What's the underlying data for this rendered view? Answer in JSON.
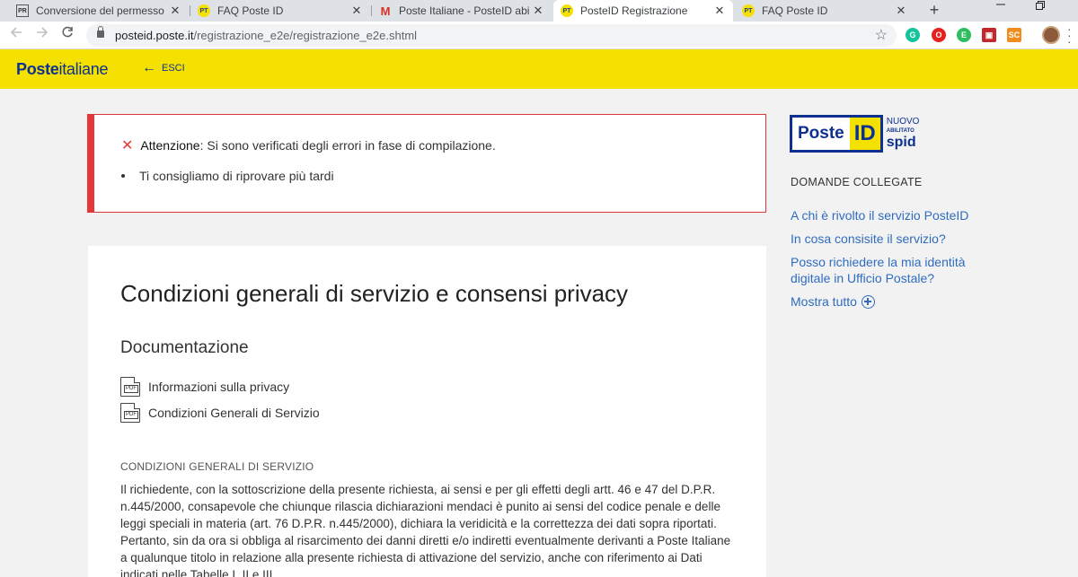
{
  "browser": {
    "tabs": [
      {
        "title": "Conversione del permesso di s",
        "favicon": "pr",
        "active": false
      },
      {
        "title": "FAQ Poste ID",
        "favicon": "pt",
        "active": false
      },
      {
        "title": "Poste Italiane - PosteID abilitat",
        "favicon": "gm",
        "active": false
      },
      {
        "title": "PosteID Registrazione",
        "favicon": "pt",
        "active": true
      },
      {
        "title": "FAQ Poste ID",
        "favicon": "pt",
        "active": false
      }
    ],
    "favicon_text": {
      "pt": "PT",
      "gm": "M",
      "pr": "PR"
    },
    "close_glyph": "✕",
    "new_tab": "+",
    "url_host": "posteid.poste.it",
    "url_path": "/registrazione_e2e/registrazione_e2e.shtml",
    "extensions": [
      {
        "name": "grammarly-icon",
        "color": "#15c39a",
        "text": "G"
      },
      {
        "name": "opera-icon",
        "color": "#e5201d",
        "text": "O"
      },
      {
        "name": "evernote-icon",
        "color": "#2dbe60",
        "text": "E"
      },
      {
        "name": "extension-icon",
        "color": "#c1272d",
        "text": "▣"
      },
      {
        "name": "sc-extension-icon",
        "color": "#f08c1e",
        "text": "SC"
      }
    ]
  },
  "header": {
    "logo_bold": "Poste",
    "logo_regular": "italiane",
    "exit_label": "ESCI"
  },
  "alert": {
    "label": "Attenzione",
    "message": ": Si sono verificati degli errori in fase di compilazione.",
    "bullet": "Ti consigliamo di riprovare più tardi"
  },
  "main": {
    "title": "Condizioni generali di servizio e consensi privacy",
    "doc_heading": "Documentazione",
    "documents": [
      "Informazioni sulla privacy",
      "Condizioni Generali di Servizio"
    ],
    "pdf_label": "PDF",
    "cond_heading": "CONDIZIONI GENERALI DI SERVIZIO",
    "cond_body": "Il richiedente, con la sottoscrizione della presente richiesta, ai sensi e per gli effetti degli artt. 46 e 47 del D.P.R. n.445/2000, consapevole che chiunque rilascia dichiarazioni mendaci è punito ai sensi del codice penale e delle leggi speciali in materia (art. 76 D.P.R. n.445/2000), dichiara la veridicità e la correttezza dei dati sopra riportati. Pertanto, sin da ora si obbliga al risarcimento dei danni diretti e/o indiretti eventualmente derivanti a Poste Italiane a qualunque titolo in relazione alla presente richiesta di attivazione del servizio, anche con riferimento ai Dati indicati nelle Tabelle I, II e III"
  },
  "sidebar": {
    "badge_poste": "Poste",
    "badge_id": "ID",
    "badge_nuovo": "NUOVO",
    "badge_abilitato": "ABILITATO",
    "badge_spid": "spid",
    "related_title": "DOMANDE COLLEGATE",
    "links": [
      "A chi è rivolto il servizio PosteID",
      "In cosa consisite il servizio?",
      "Posso richiedere la mia identità digitale in Ufficio Postale?"
    ],
    "show_all": "Mostra tutto"
  }
}
